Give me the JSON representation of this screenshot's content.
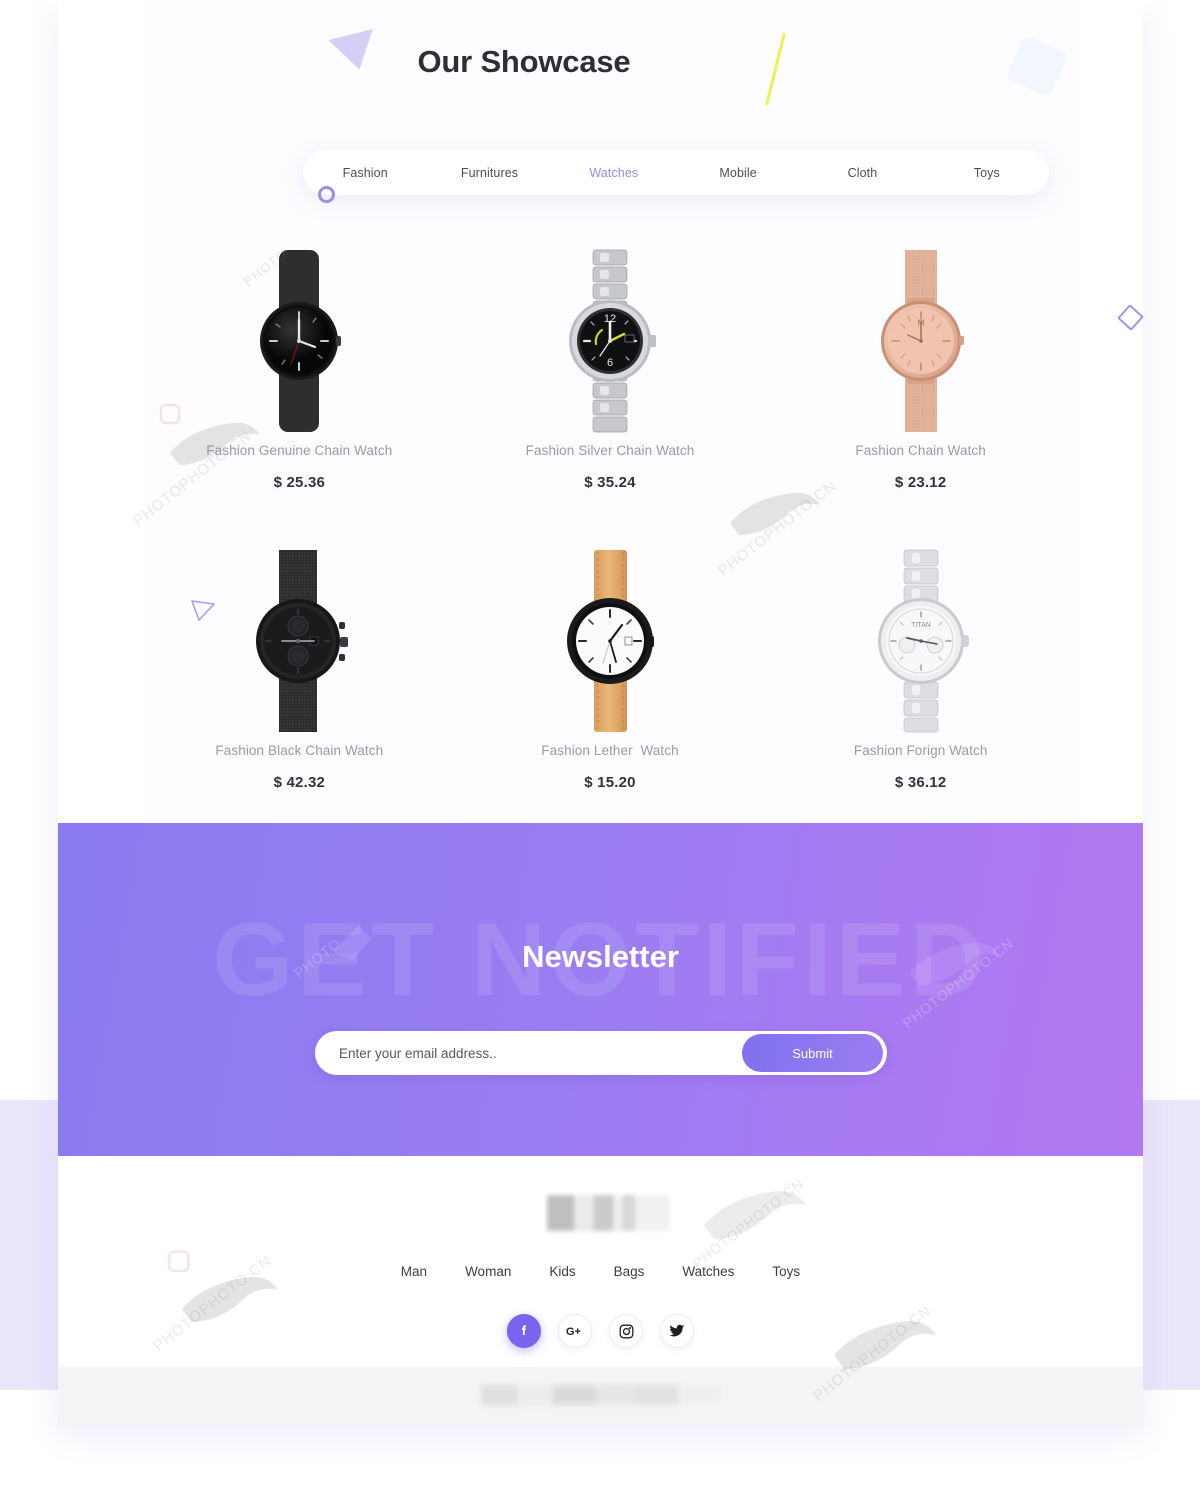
{
  "showcase": {
    "title": "Our Showcase",
    "tabs": [
      {
        "label": "Fashion",
        "active": false
      },
      {
        "label": "Furnitures",
        "active": false
      },
      {
        "label": "Watches",
        "active": true
      },
      {
        "label": "Mobile",
        "active": false
      },
      {
        "label": "Cloth",
        "active": false
      },
      {
        "label": "Toys",
        "active": false
      }
    ],
    "products": [
      {
        "name": "Fashion Genuine Chain Watch",
        "price": "$ 25.36",
        "style": "black-rubber"
      },
      {
        "name": "Fashion Silver Chain Watch",
        "price": "$ 35.24",
        "style": "silver-bracelet"
      },
      {
        "name": "Fashion Chain Watch",
        "price": "$ 23.12",
        "style": "rose-gold-mesh"
      },
      {
        "name": "Fashion Black Chain Watch",
        "price": "$ 42.32",
        "style": "black-mesh-chrono"
      },
      {
        "name": "Fashion Lether  Watch",
        "price": "$ 15.20",
        "style": "tan-leather"
      },
      {
        "name": "Fashion Forign Watch",
        "price": "$ 36.12",
        "style": "white-steel-chrono"
      }
    ]
  },
  "newsletter": {
    "watermark": "GET NOTIFIED",
    "title": "Newsletter",
    "email_placeholder": "Enter your email address..",
    "email_value": "",
    "submit_label": "Submit"
  },
  "footer": {
    "nav": [
      "Man",
      "Woman",
      "Kids",
      "Bags",
      "Watches",
      "Toys"
    ],
    "socials": [
      {
        "name": "facebook-icon",
        "glyph": "f",
        "filled": true
      },
      {
        "name": "google-plus-icon",
        "glyph": "G+",
        "filled": false
      },
      {
        "name": "instagram-icon",
        "glyph": "▢",
        "filled": false
      },
      {
        "name": "twitter-icon",
        "glyph": "✐",
        "filled": false
      }
    ]
  },
  "watermarks": {
    "photo_cn": "PHOTOPHOTO.CN",
    "photo": "PHOTO"
  },
  "colors": {
    "accent_purple": "#9b8bf0",
    "newsletter_from": "#8a7bf0",
    "newsletter_to": "#b478f0",
    "social_filled": "#7c63ef",
    "yellow_slash": "#eef04a",
    "page_lavender": "#ebe7fb"
  }
}
